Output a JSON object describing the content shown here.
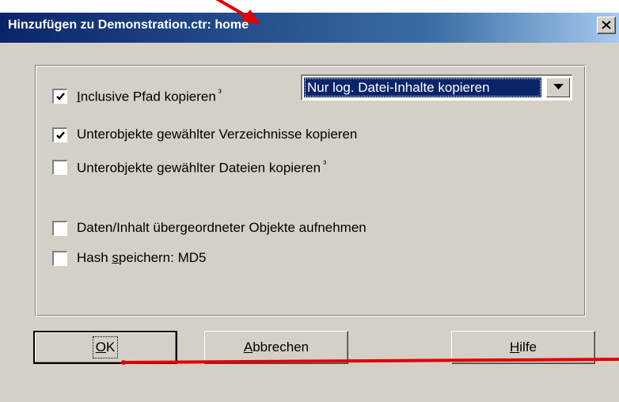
{
  "window": {
    "title": "Hinzufügen zu Demonstration.ctr: home",
    "close_icon": "close-icon"
  },
  "options": {
    "include_path": {
      "label_u": "I",
      "label_rest": "nclusive Pfad kopieren",
      "note": "³",
      "checked": true
    },
    "copy_mode": {
      "selected": "Nur log. Datei-Inhalte kopieren"
    },
    "subobjects_dirs": {
      "label": "Unterobjekte gewählter Verzeichnisse kopieren",
      "checked": true
    },
    "subobjects_files": {
      "label": "Unterobjekte gewählter Dateien kopieren",
      "note": "³",
      "checked": false
    },
    "parent_data": {
      "label": "Daten/Inhalt übergeordneter Objekte aufnehmen",
      "checked": false
    },
    "hash": {
      "label_pre": "Hash ",
      "label_u": "s",
      "label_rest": "peichern: MD5",
      "checked": false
    }
  },
  "buttons": {
    "ok_u": "O",
    "ok_rest": "K",
    "cancel_u": "A",
    "cancel_rest": "bbrechen",
    "help_u": "H",
    "help_rest": "ilfe"
  },
  "colors": {
    "annotation": "#e00000",
    "title_bar": "#0a246a",
    "dialog_bg": "#d4d0c8"
  }
}
